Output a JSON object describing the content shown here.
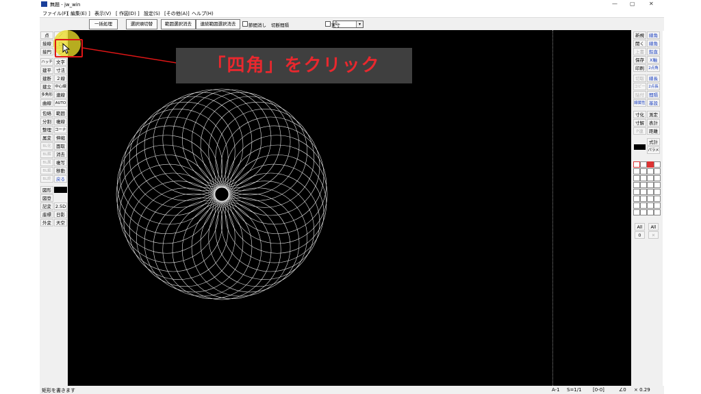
{
  "window": {
    "title": "無題 - jw_win",
    "controls": [
      "—",
      "▢",
      "✕"
    ]
  },
  "menu": [
    "ファイル(F)",
    "[ 編集(E) ]",
    "表示(V)",
    "[ 作図(D) ]",
    "設定(S)",
    "[その他(A)]",
    "ヘルプ(H)"
  ],
  "toolbar": {
    "buttons": [
      "一括処理",
      "選択順切替",
      "範囲選択消去",
      "連続範囲選択消去"
    ],
    "check1": "節間消し",
    "interval_label": "切断間隔",
    "interval_value": "0",
    "check2": "実寸"
  },
  "left_tools": [
    [
      "点",
      "／"
    ],
    [
      "接線",
      "□"
    ],
    [
      "接円",
      "○"
    ],
    [
      "ハッチ",
      "文字"
    ],
    [
      "建平",
      "寸法"
    ],
    [
      "建断",
      "２線"
    ],
    [
      "建立",
      "中心線"
    ],
    [
      "多角形",
      "連線"
    ],
    [
      "曲線",
      "AUTO"
    ],
    [
      "包絡",
      "範囲"
    ],
    [
      "分割",
      "複線"
    ],
    [
      "整理",
      "コーナー"
    ],
    [
      "属変",
      "伸縮"
    ],
    [
      "BL化",
      "面取"
    ],
    [
      "BL解",
      "消去"
    ],
    [
      "BL属",
      "複写"
    ],
    [
      "BL編",
      "移動"
    ],
    [
      "BL終",
      "戻る"
    ]
  ],
  "left_bottom": {
    "zukei": "図形",
    "tools": [
      [
        "図登",
        ""
      ],
      [
        "記変",
        "2.5D"
      ],
      [
        "座標",
        "日影"
      ],
      [
        "外変",
        "天空"
      ]
    ]
  },
  "right_tools": [
    [
      "新規",
      "線角"
    ],
    [
      "開く",
      "線角"
    ],
    [
      "上書",
      "鉛直"
    ],
    [
      "保存",
      "X軸"
    ],
    [
      "印刷",
      "2点角"
    ],
    [
      "切取",
      "線長"
    ],
    [
      "コピー",
      "2点長"
    ],
    [
      "貼付",
      "間隔"
    ],
    [
      "線属性",
      "基設"
    ],
    [
      "寸化",
      "測定"
    ],
    [
      "寸解",
      "表計"
    ],
    [
      "P連",
      "距離"
    ],
    [
      "",
      "式計"
    ],
    [
      "",
      "パラメ"
    ]
  ],
  "right_bottom": [
    "All",
    "All",
    "0",
    "✕"
  ],
  "status": {
    "message": "矩形を書きます",
    "paper": "A-1",
    "scale": "S=1/1",
    "layer": "[0-0]",
    "angle": "∠0",
    "zoom": "× 0.29"
  },
  "annotation": {
    "callout_text": "「四角」をクリック",
    "accent": "#e8282e"
  }
}
